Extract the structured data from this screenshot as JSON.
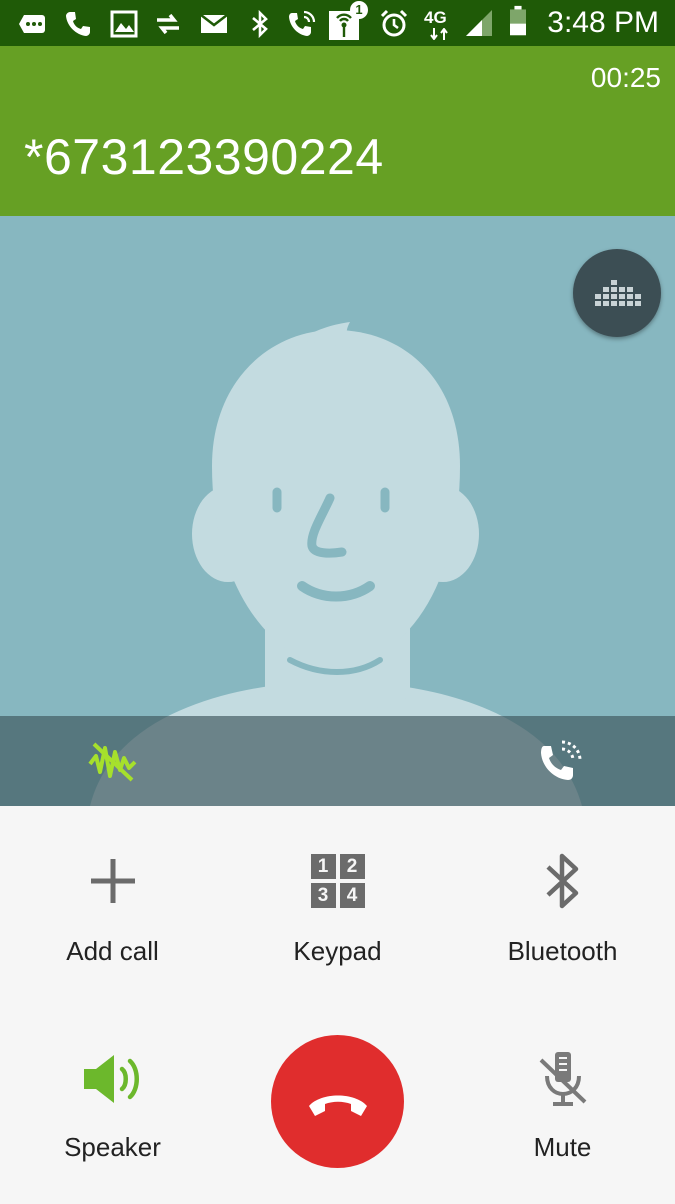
{
  "status_bar": {
    "time": "3:48 PM",
    "network_label": "4G",
    "notification_count": "1",
    "icons": [
      "more-icon",
      "phone-icon",
      "image-icon",
      "sync-icon",
      "mail-icon",
      "bluetooth-icon",
      "wifi-calling-icon",
      "broadcast-icon",
      "alarm-icon",
      "network-4g-icon",
      "signal-icon",
      "battery-icon"
    ]
  },
  "call": {
    "timer": "00:25",
    "number": "*673123390224"
  },
  "photo": {
    "background": "#87b7c0",
    "avatar_color": "#c3dbe0",
    "feature_color": "#87b7c0",
    "icons": [
      "equalizer-icon",
      "noise-reduction-icon",
      "hd-call-icon"
    ]
  },
  "controls": {
    "add_call_label": "Add call",
    "keypad_label": "Keypad",
    "keypad_digits": [
      "1",
      "2",
      "3",
      "4"
    ],
    "bluetooth_label": "Bluetooth",
    "speaker_label": "Speaker",
    "mute_label": "Mute",
    "speaker_color": "#6cb82c",
    "end_call_color": "#e02d2d"
  }
}
